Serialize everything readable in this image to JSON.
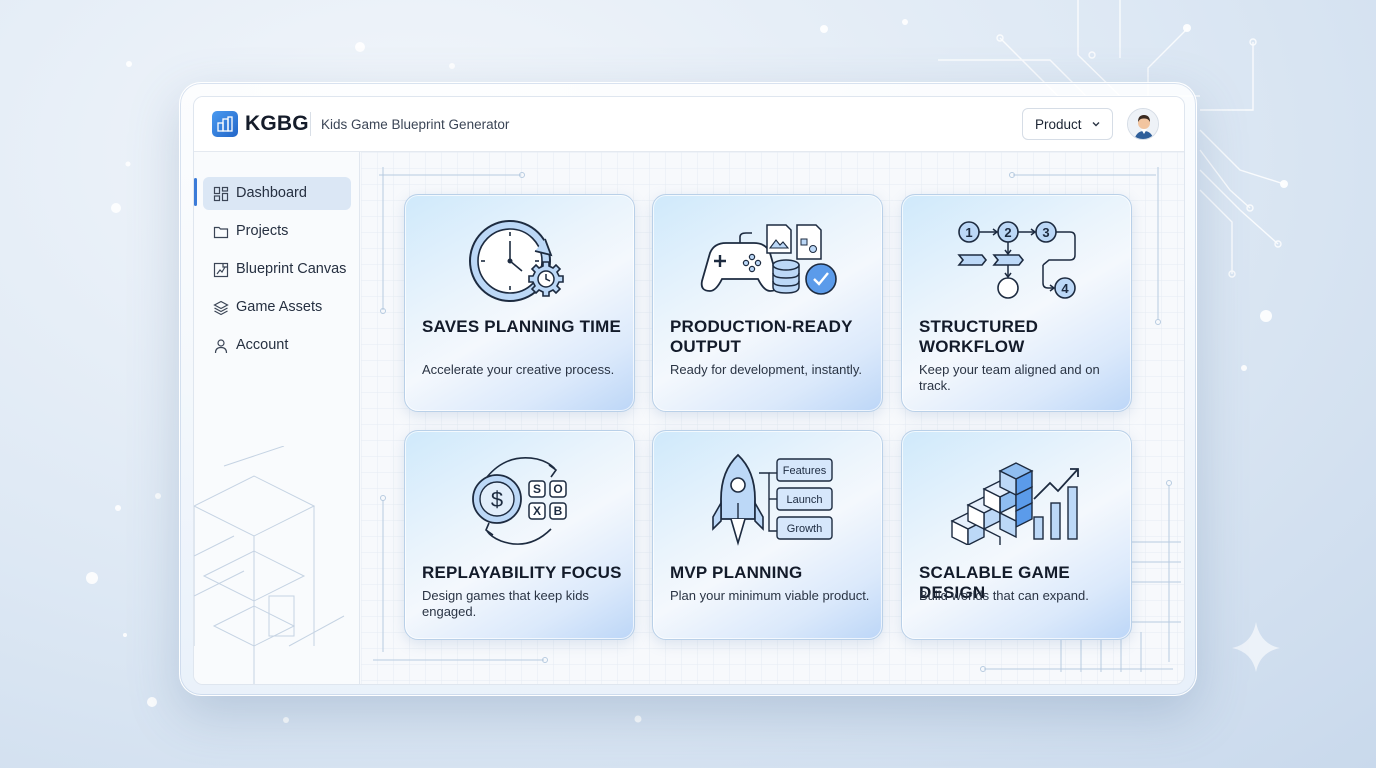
{
  "app": {
    "brand": "KGBG",
    "subtitle": "Kids Game Blueprint Generator"
  },
  "header": {
    "product_label": "Product",
    "icons": [
      "logo-icon",
      "chevron-down-icon",
      "avatar"
    ]
  },
  "sidebar": {
    "items": [
      {
        "label": "Dashboard",
        "icon": "dashboard-icon",
        "active": true
      },
      {
        "label": "Projects",
        "icon": "folder-icon",
        "active": false
      },
      {
        "label": "Blueprint Canvas",
        "icon": "blueprint-icon",
        "active": false
      },
      {
        "label": "Game Assets",
        "icon": "layers-icon",
        "active": false
      },
      {
        "label": "Account",
        "icon": "user-icon",
        "active": false
      }
    ]
  },
  "cards": [
    {
      "title": "SAVES PLANNING TIME",
      "desc": "Accelerate your creative process.",
      "icon": "clock-gear-icon"
    },
    {
      "title": "PRODUCTION-READY OUTPUT",
      "desc": "Ready for development, instantly.",
      "icon": "gamepad-files-icon"
    },
    {
      "title": "STRUCTURED WORKFLOW",
      "desc": "Keep your team aligned and on track.",
      "icon": "flowchart-icon"
    },
    {
      "title": "REPLAYABILITY FOCUS",
      "desc": "Design games that keep kids engaged.",
      "icon": "coin-cycle-icon",
      "tiles": [
        "S",
        "O",
        "X",
        "B"
      ],
      "coin_symbol": "$"
    },
    {
      "title": "MVP PLANNING",
      "desc": "Plan your minimum viable product.",
      "icon": "rocket-icon",
      "stages": [
        "Features",
        "Launch",
        "Growth"
      ]
    },
    {
      "title": "SCALABLE GAME DESIGN",
      "desc": "Build worlds that can expand.",
      "icon": "cubes-chart-icon"
    }
  ],
  "flow_steps": [
    "1",
    "2",
    "3",
    "4"
  ],
  "colors": {
    "accent": "#3b7bd8",
    "icon_fill": "#bcd8f7",
    "icon_stroke": "#1d2b40",
    "active_nav_bg": "#dbe7f5"
  }
}
